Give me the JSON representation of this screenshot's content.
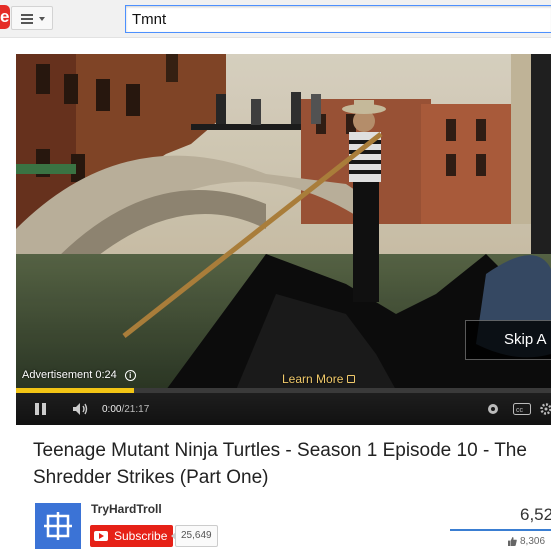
{
  "masthead": {
    "logo_letter": "e",
    "logo_icon": "youtube-logo",
    "guide_icon": "hamburger-menu-icon",
    "search_value": "Tmnt"
  },
  "player": {
    "ad_label": "Advertisement 0:24",
    "ad_info_icon": "i",
    "learn_more": "Learn More",
    "skip_label": "Skip A",
    "progress_fraction": 0.22,
    "time_current": "0:00",
    "time_separator": " / ",
    "time_total": "21:17",
    "accent_color": "#f2c515"
  },
  "video": {
    "title": "Teenage Mutant Ninja Turtles - Season 1 Episode 10 - The Shredder Strikes (Part One)"
  },
  "channel": {
    "name": "TryHardTroll",
    "subscribe_label": "Subscribe",
    "subscriber_count": "25,649",
    "view_count": "6,52",
    "like_count": "8,306",
    "brand_color": "#e62117"
  }
}
